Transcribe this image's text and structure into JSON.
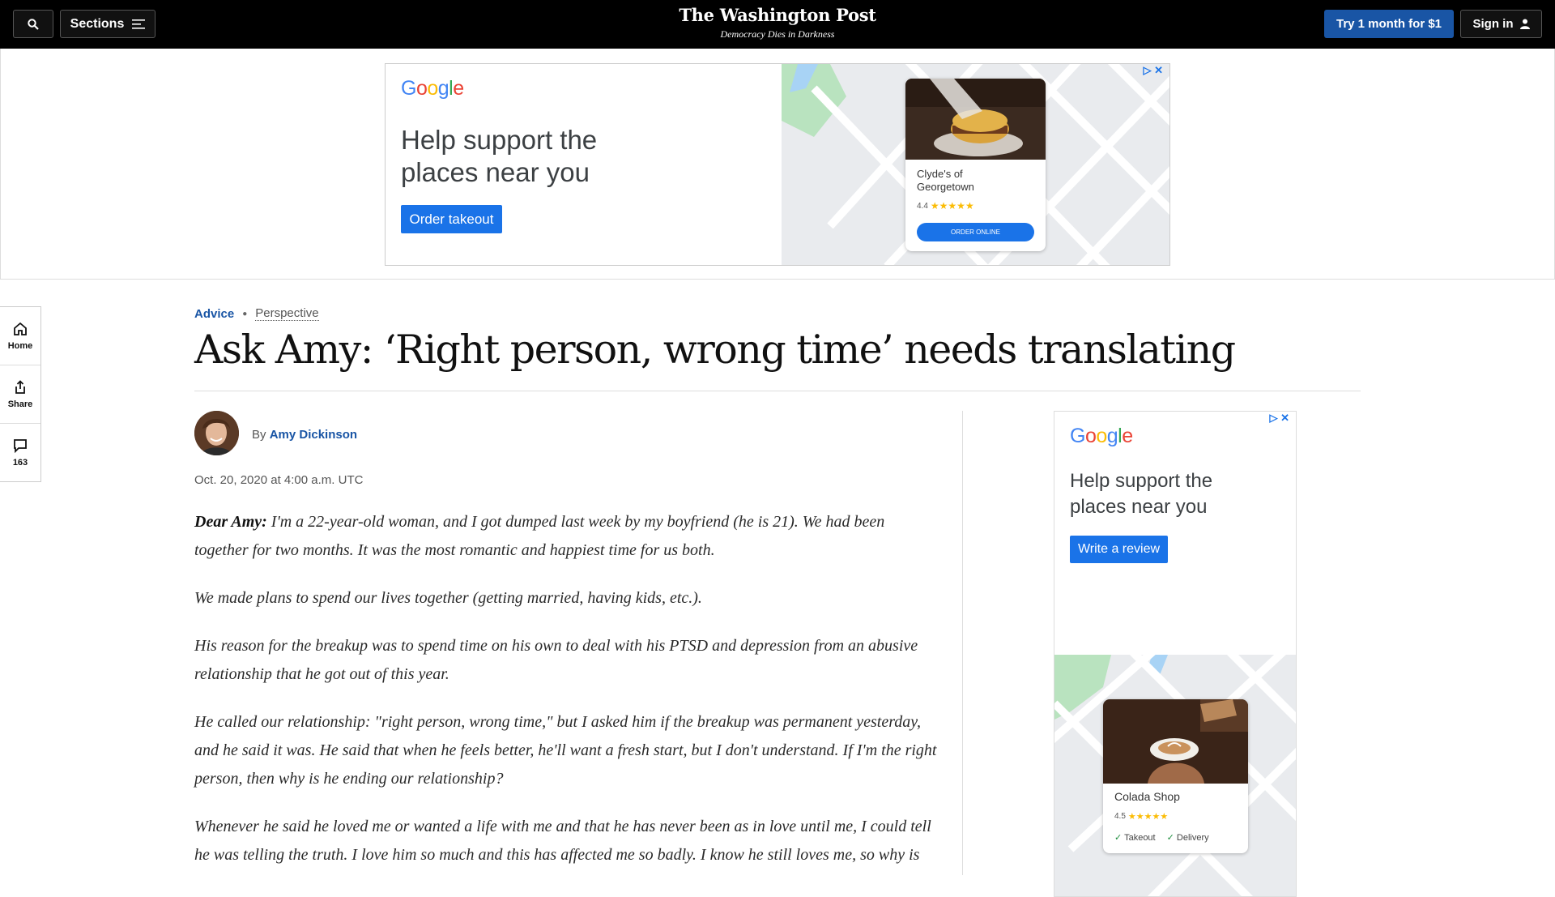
{
  "header": {
    "sections_label": "Sections",
    "logo_name": "The Washington Post",
    "tagline": "Democracy Dies in Darkness",
    "subscribe_label": "Try 1 month for $1",
    "signin_label": "Sign in",
    "brand_blue": "#1955a5"
  },
  "top_ad": {
    "headline_line1": "Help support the",
    "headline_line2": "places near you",
    "cta": "Order takeout",
    "place_name_line1": "Clyde's of",
    "place_name_line2": "Georgetown",
    "rating": "4.4",
    "stars": 4.4,
    "order_label": "ORDER ONLINE"
  },
  "rail": {
    "home_label": "Home",
    "share_label": "Share",
    "comments_count": "163"
  },
  "article": {
    "section": "Advice",
    "label": "Perspective",
    "headline": "Ask Amy: ‘Right person, wrong time’ needs translating",
    "byline_prefix": "By",
    "author": "Amy Dickinson",
    "date": "Oct. 20, 2020 at 4:00 a.m. UTC",
    "lead": "Dear Amy:",
    "p1": " I'm a 22-year-old woman, and I got dumped last week by my boyfriend (he is 21). We had been together for two months. It was the most romantic and happiest time for us both.",
    "p2": "We made plans to spend our lives together (getting married, having kids, etc.).",
    "p3": "His reason for the breakup was to spend time on his own to deal with his PTSD and depression from an abusive relationship that he got out of this year.",
    "p4": "He called our relationship: \"right person, wrong time,\" but I asked him if the breakup was permanent yesterday, and he said it was. He said that when he feels better, he'll want a fresh start, but I don't understand. If I'm the right person, then why is he ending our relationship?",
    "p5": "Whenever he said he loved me or wanted a life with me and that he has never been as in love until me, I could tell he was telling the truth. I love him so much and this has affected me so badly. I know he still loves me, so why is"
  },
  "side_ad": {
    "headline_line1": "Help support the",
    "headline_line2": "places near you",
    "cta": "Write a review",
    "place_name": "Colada Shop",
    "rating": "4.5",
    "stars": 4.5,
    "tag1": "Takeout",
    "tag2": "Delivery"
  }
}
